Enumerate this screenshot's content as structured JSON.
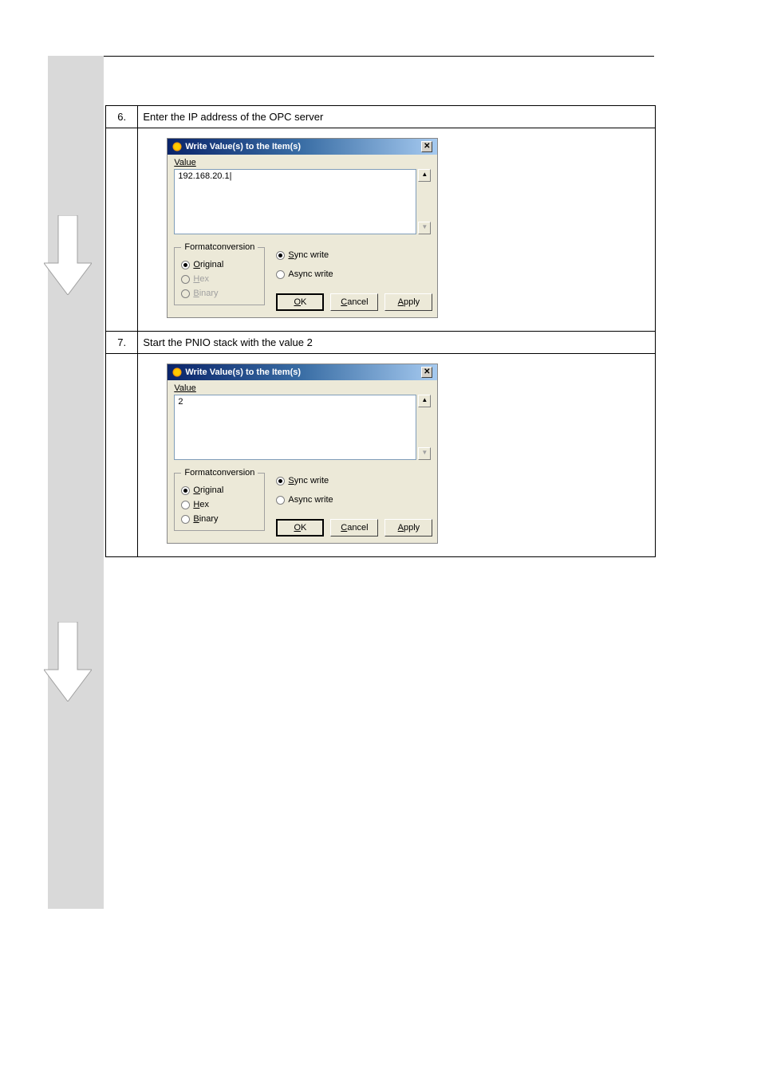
{
  "dialog_title": "Write Value(s) to the Item(s)",
  "value_label": "Value",
  "groups": {
    "format_conversion": "Formatconversion",
    "original": "Original",
    "hex": "Hex",
    "binary": "Binary",
    "sync_write": "Sync write",
    "async_write": "Async write"
  },
  "buttons": {
    "ok": "OK",
    "cancel": "Cancel",
    "apply": "Apply"
  },
  "step6": {
    "num": "6.",
    "description": "Enter the IP address of the OPC server",
    "value": "192.168.20.1|"
  },
  "step7": {
    "num": "7.",
    "description": "Start the PNIO stack with the value 2",
    "value": "2"
  },
  "scroll_up": "▲",
  "scroll_down": "▼"
}
